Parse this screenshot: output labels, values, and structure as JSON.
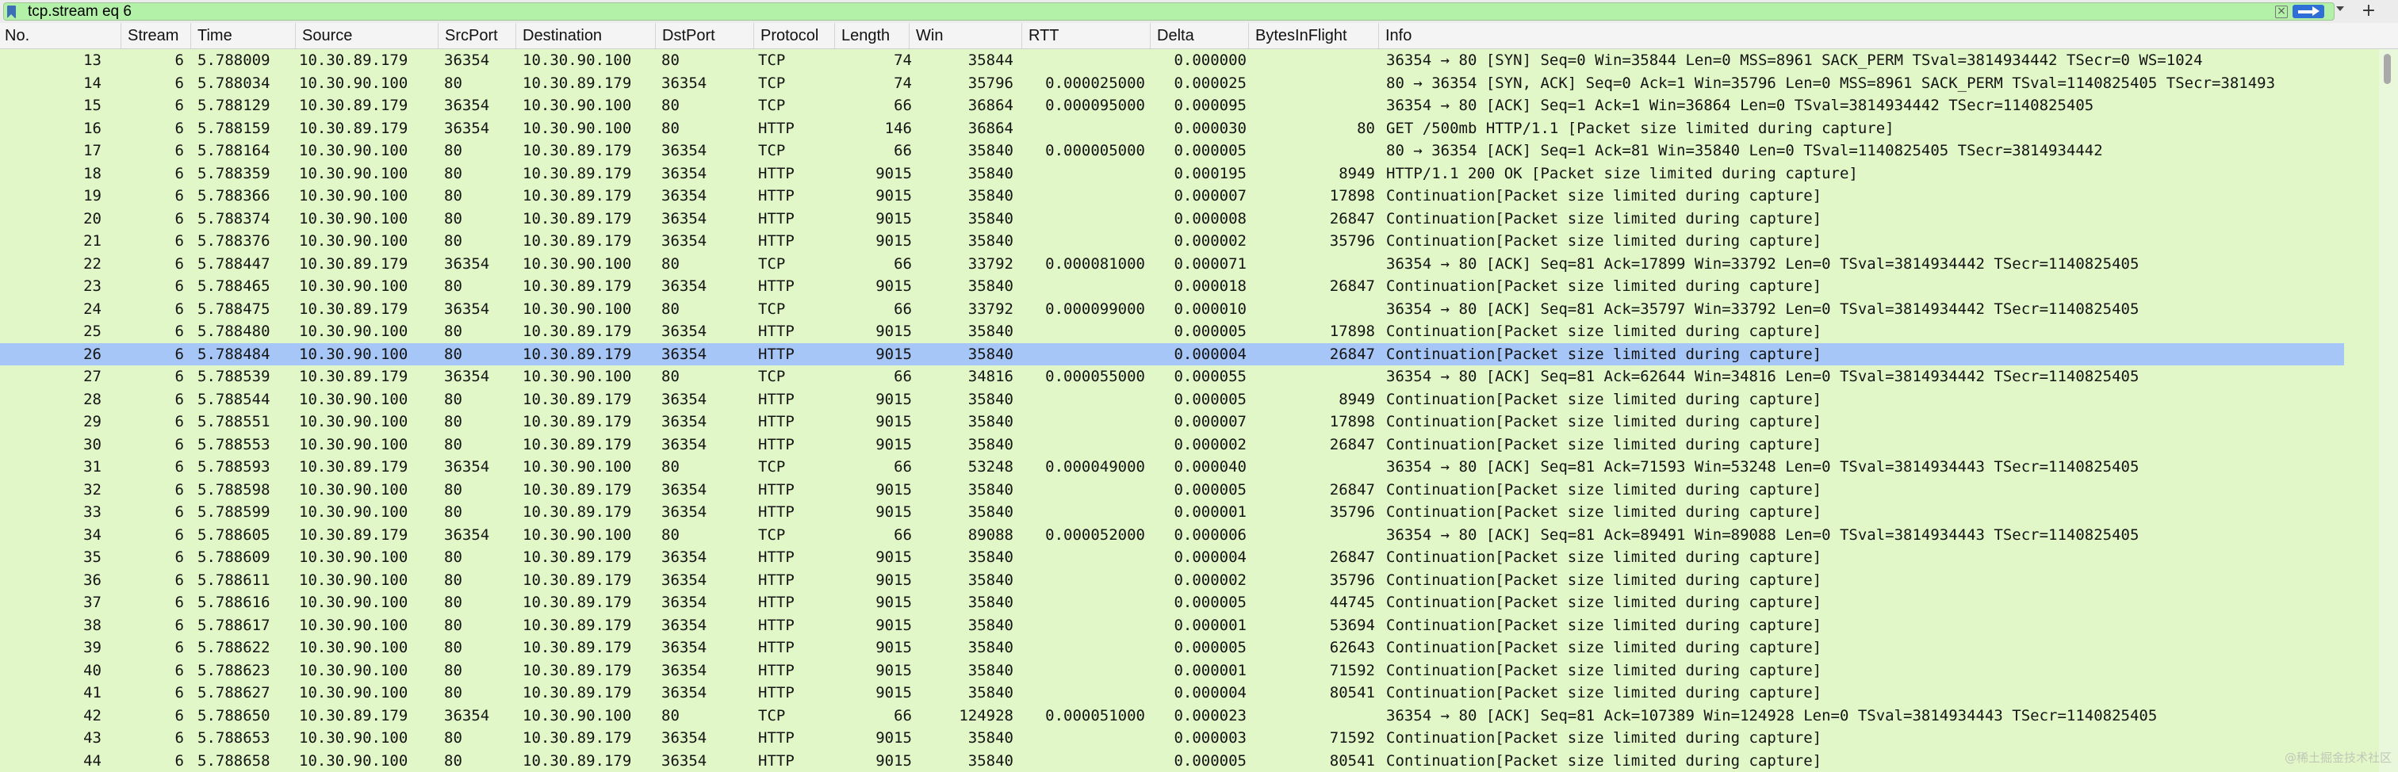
{
  "filter": {
    "value": "tcp.stream eq 6"
  },
  "icons": {
    "bookmark": "bookmark-icon",
    "clear": "clear-icon",
    "apply": "apply-arrow-icon",
    "dropdown": "chevron-down-icon",
    "add": "plus-icon"
  },
  "colors": {
    "filter_valid": "#b3f0a8",
    "row_bg": "#e2f7c8",
    "selected_bg": "#a5c6f7",
    "apply_button": "#2f6fd6"
  },
  "columns": [
    "No.",
    "Stream",
    "Time",
    "Source",
    "SrcPort",
    "Destination",
    "DstPort",
    "Protocol",
    "Length",
    "Win",
    "RTT",
    "Delta",
    "BytesInFlight",
    "Info"
  ],
  "selected_packet": "26",
  "packets": [
    [
      "13",
      "6",
      "5.788009",
      "10.30.89.179",
      "36354",
      "10.30.90.100",
      "80",
      "TCP",
      "74",
      "35844",
      "",
      "0.000000",
      "",
      "36354 → 80 [SYN] Seq=0 Win=35844 Len=0 MSS=8961 SACK_PERM TSval=3814934442 TSecr=0 WS=1024"
    ],
    [
      "14",
      "6",
      "5.788034",
      "10.30.90.100",
      "80",
      "10.30.89.179",
      "36354",
      "TCP",
      "74",
      "35796",
      "0.000025000",
      "0.000025",
      "",
      "80 → 36354 [SYN, ACK] Seq=0 Ack=1 Win=35796 Len=0 MSS=8961 SACK_PERM TSval=1140825405 TSecr=381493"
    ],
    [
      "15",
      "6",
      "5.788129",
      "10.30.89.179",
      "36354",
      "10.30.90.100",
      "80",
      "TCP",
      "66",
      "36864",
      "0.000095000",
      "0.000095",
      "",
      "36354 → 80 [ACK] Seq=1 Ack=1 Win=36864 Len=0 TSval=3814934442 TSecr=1140825405"
    ],
    [
      "16",
      "6",
      "5.788159",
      "10.30.89.179",
      "36354",
      "10.30.90.100",
      "80",
      "HTTP",
      "146",
      "36864",
      "",
      "0.000030",
      "80",
      "GET /500mb HTTP/1.1 [Packet size limited during capture]"
    ],
    [
      "17",
      "6",
      "5.788164",
      "10.30.90.100",
      "80",
      "10.30.89.179",
      "36354",
      "TCP",
      "66",
      "35840",
      "0.000005000",
      "0.000005",
      "",
      "80 → 36354 [ACK] Seq=1 Ack=81 Win=35840 Len=0 TSval=1140825405 TSecr=3814934442"
    ],
    [
      "18",
      "6",
      "5.788359",
      "10.30.90.100",
      "80",
      "10.30.89.179",
      "36354",
      "HTTP",
      "9015",
      "35840",
      "",
      "0.000195",
      "8949",
      "HTTP/1.1 200 OK [Packet size limited during capture]"
    ],
    [
      "19",
      "6",
      "5.788366",
      "10.30.90.100",
      "80",
      "10.30.89.179",
      "36354",
      "HTTP",
      "9015",
      "35840",
      "",
      "0.000007",
      "17898",
      "Continuation[Packet size limited during capture]"
    ],
    [
      "20",
      "6",
      "5.788374",
      "10.30.90.100",
      "80",
      "10.30.89.179",
      "36354",
      "HTTP",
      "9015",
      "35840",
      "",
      "0.000008",
      "26847",
      "Continuation[Packet size limited during capture]"
    ],
    [
      "21",
      "6",
      "5.788376",
      "10.30.90.100",
      "80",
      "10.30.89.179",
      "36354",
      "HTTP",
      "9015",
      "35840",
      "",
      "0.000002",
      "35796",
      "Continuation[Packet size limited during capture]"
    ],
    [
      "22",
      "6",
      "5.788447",
      "10.30.89.179",
      "36354",
      "10.30.90.100",
      "80",
      "TCP",
      "66",
      "33792",
      "0.000081000",
      "0.000071",
      "",
      "36354 → 80 [ACK] Seq=81 Ack=17899 Win=33792 Len=0 TSval=3814934442 TSecr=1140825405"
    ],
    [
      "23",
      "6",
      "5.788465",
      "10.30.90.100",
      "80",
      "10.30.89.179",
      "36354",
      "HTTP",
      "9015",
      "35840",
      "",
      "0.000018",
      "26847",
      "Continuation[Packet size limited during capture]"
    ],
    [
      "24",
      "6",
      "5.788475",
      "10.30.89.179",
      "36354",
      "10.30.90.100",
      "80",
      "TCP",
      "66",
      "33792",
      "0.000099000",
      "0.000010",
      "",
      "36354 → 80 [ACK] Seq=81 Ack=35797 Win=33792 Len=0 TSval=3814934442 TSecr=1140825405"
    ],
    [
      "25",
      "6",
      "5.788480",
      "10.30.90.100",
      "80",
      "10.30.89.179",
      "36354",
      "HTTP",
      "9015",
      "35840",
      "",
      "0.000005",
      "17898",
      "Continuation[Packet size limited during capture]"
    ],
    [
      "26",
      "6",
      "5.788484",
      "10.30.90.100",
      "80",
      "10.30.89.179",
      "36354",
      "HTTP",
      "9015",
      "35840",
      "",
      "0.000004",
      "26847",
      "Continuation[Packet size limited during capture]"
    ],
    [
      "27",
      "6",
      "5.788539",
      "10.30.89.179",
      "36354",
      "10.30.90.100",
      "80",
      "TCP",
      "66",
      "34816",
      "0.000055000",
      "0.000055",
      "",
      "36354 → 80 [ACK] Seq=81 Ack=62644 Win=34816 Len=0 TSval=3814934442 TSecr=1140825405"
    ],
    [
      "28",
      "6",
      "5.788544",
      "10.30.90.100",
      "80",
      "10.30.89.179",
      "36354",
      "HTTP",
      "9015",
      "35840",
      "",
      "0.000005",
      "8949",
      "Continuation[Packet size limited during capture]"
    ],
    [
      "29",
      "6",
      "5.788551",
      "10.30.90.100",
      "80",
      "10.30.89.179",
      "36354",
      "HTTP",
      "9015",
      "35840",
      "",
      "0.000007",
      "17898",
      "Continuation[Packet size limited during capture]"
    ],
    [
      "30",
      "6",
      "5.788553",
      "10.30.90.100",
      "80",
      "10.30.89.179",
      "36354",
      "HTTP",
      "9015",
      "35840",
      "",
      "0.000002",
      "26847",
      "Continuation[Packet size limited during capture]"
    ],
    [
      "31",
      "6",
      "5.788593",
      "10.30.89.179",
      "36354",
      "10.30.90.100",
      "80",
      "TCP",
      "66",
      "53248",
      "0.000049000",
      "0.000040",
      "",
      "36354 → 80 [ACK] Seq=81 Ack=71593 Win=53248 Len=0 TSval=3814934443 TSecr=1140825405"
    ],
    [
      "32",
      "6",
      "5.788598",
      "10.30.90.100",
      "80",
      "10.30.89.179",
      "36354",
      "HTTP",
      "9015",
      "35840",
      "",
      "0.000005",
      "26847",
      "Continuation[Packet size limited during capture]"
    ],
    [
      "33",
      "6",
      "5.788599",
      "10.30.90.100",
      "80",
      "10.30.89.179",
      "36354",
      "HTTP",
      "9015",
      "35840",
      "",
      "0.000001",
      "35796",
      "Continuation[Packet size limited during capture]"
    ],
    [
      "34",
      "6",
      "5.788605",
      "10.30.89.179",
      "36354",
      "10.30.90.100",
      "80",
      "TCP",
      "66",
      "89088",
      "0.000052000",
      "0.000006",
      "",
      "36354 → 80 [ACK] Seq=81 Ack=89491 Win=89088 Len=0 TSval=3814934443 TSecr=1140825405"
    ],
    [
      "35",
      "6",
      "5.788609",
      "10.30.90.100",
      "80",
      "10.30.89.179",
      "36354",
      "HTTP",
      "9015",
      "35840",
      "",
      "0.000004",
      "26847",
      "Continuation[Packet size limited during capture]"
    ],
    [
      "36",
      "6",
      "5.788611",
      "10.30.90.100",
      "80",
      "10.30.89.179",
      "36354",
      "HTTP",
      "9015",
      "35840",
      "",
      "0.000002",
      "35796",
      "Continuation[Packet size limited during capture]"
    ],
    [
      "37",
      "6",
      "5.788616",
      "10.30.90.100",
      "80",
      "10.30.89.179",
      "36354",
      "HTTP",
      "9015",
      "35840",
      "",
      "0.000005",
      "44745",
      "Continuation[Packet size limited during capture]"
    ],
    [
      "38",
      "6",
      "5.788617",
      "10.30.90.100",
      "80",
      "10.30.89.179",
      "36354",
      "HTTP",
      "9015",
      "35840",
      "",
      "0.000001",
      "53694",
      "Continuation[Packet size limited during capture]"
    ],
    [
      "39",
      "6",
      "5.788622",
      "10.30.90.100",
      "80",
      "10.30.89.179",
      "36354",
      "HTTP",
      "9015",
      "35840",
      "",
      "0.000005",
      "62643",
      "Continuation[Packet size limited during capture]"
    ],
    [
      "40",
      "6",
      "5.788623",
      "10.30.90.100",
      "80",
      "10.30.89.179",
      "36354",
      "HTTP",
      "9015",
      "35840",
      "",
      "0.000001",
      "71592",
      "Continuation[Packet size limited during capture]"
    ],
    [
      "41",
      "6",
      "5.788627",
      "10.30.90.100",
      "80",
      "10.30.89.179",
      "36354",
      "HTTP",
      "9015",
      "35840",
      "",
      "0.000004",
      "80541",
      "Continuation[Packet size limited during capture]"
    ],
    [
      "42",
      "6",
      "5.788650",
      "10.30.89.179",
      "36354",
      "10.30.90.100",
      "80",
      "TCP",
      "66",
      "124928",
      "0.000051000",
      "0.000023",
      "",
      "36354 → 80 [ACK] Seq=81 Ack=107389 Win=124928 Len=0 TSval=3814934443 TSecr=1140825405"
    ],
    [
      "43",
      "6",
      "5.788653",
      "10.30.90.100",
      "80",
      "10.30.89.179",
      "36354",
      "HTTP",
      "9015",
      "35840",
      "",
      "0.000003",
      "71592",
      "Continuation[Packet size limited during capture]"
    ],
    [
      "44",
      "6",
      "5.788658",
      "10.30.90.100",
      "80",
      "10.30.89.179",
      "36354",
      "HTTP",
      "9015",
      "35840",
      "",
      "0.000005",
      "80541",
      "Continuation[Packet size limited during capture]"
    ]
  ],
  "watermark": "@稀土掘金技术社区"
}
